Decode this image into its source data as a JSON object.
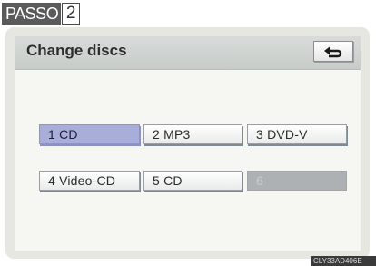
{
  "step": {
    "word": "PASSO",
    "number": "2"
  },
  "header": {
    "title": "Change discs",
    "back_icon": "return-arrow-icon"
  },
  "discs": [
    {
      "slot": "1",
      "label": "1  CD",
      "state": "selected"
    },
    {
      "slot": "2",
      "label": "2  MP3",
      "state": "normal"
    },
    {
      "slot": "3",
      "label": "3  DVD-V",
      "state": "normal"
    },
    {
      "slot": "4",
      "label": "4  Video-CD",
      "state": "normal"
    },
    {
      "slot": "5",
      "label": "5  CD",
      "state": "normal"
    },
    {
      "slot": "6",
      "label": "6",
      "state": "disabled"
    }
  ],
  "colors": {
    "selected": "#a8aed9",
    "disabled": "#aeb1b3",
    "header": "#d3d6d4"
  },
  "caption": "CLY33AD406E"
}
